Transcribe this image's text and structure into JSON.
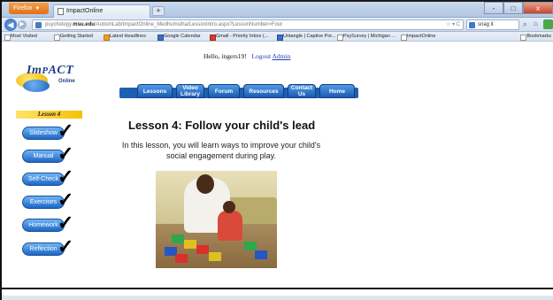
{
  "browser": {
    "menu_button": "Firefox",
    "tab_title": "ImpactOnline",
    "new_tab": "+",
    "window_controls": {
      "minimize": "-",
      "maximize": "□",
      "close": "x"
    },
    "url_prefix": "psychology.",
    "url_domain": "msu.edu",
    "url_rest": "/AutismLab/ImpactOnline_Medhumstha/LessonIntro.aspx?LessonNumber=Four",
    "url_right": "☆ ▾ C",
    "search_value": "snag it",
    "bookmarks": [
      "Most Visited",
      "Getting Started",
      "Latest Headlines",
      "Google Calendar",
      "Gmail - Priority Inbox (...",
      "Untangle | Captive Por...",
      "PsySurvey | Michigan ...",
      "ImpactOnline"
    ],
    "bookmarks_menu": "Bookmarks"
  },
  "header": {
    "hello": "Hello, ingers19!",
    "logout": "Logout",
    "admin": "Admin"
  },
  "logo": {
    "brand_i": "Im",
    "brand_p": "P",
    "brand_rest": "ACT",
    "sub": "Online"
  },
  "topnav": {
    "lessons": "Lessons",
    "video_line1": "Video",
    "video_line2": "Library",
    "forum": "Forum",
    "resources": "Resources",
    "contact_line1": "Contact",
    "contact_line2": "Us",
    "home": "Home"
  },
  "sidebar": {
    "lesson_label": "Lesson 4",
    "items": [
      "Slideshow",
      "Manual",
      "Self-Check",
      "Exercises",
      "Homework",
      "Reflection"
    ]
  },
  "main": {
    "title": "Lesson 4: Follow your child's lead",
    "description": "In this lesson, you will learn ways to improve your child's social engagement during play."
  }
}
